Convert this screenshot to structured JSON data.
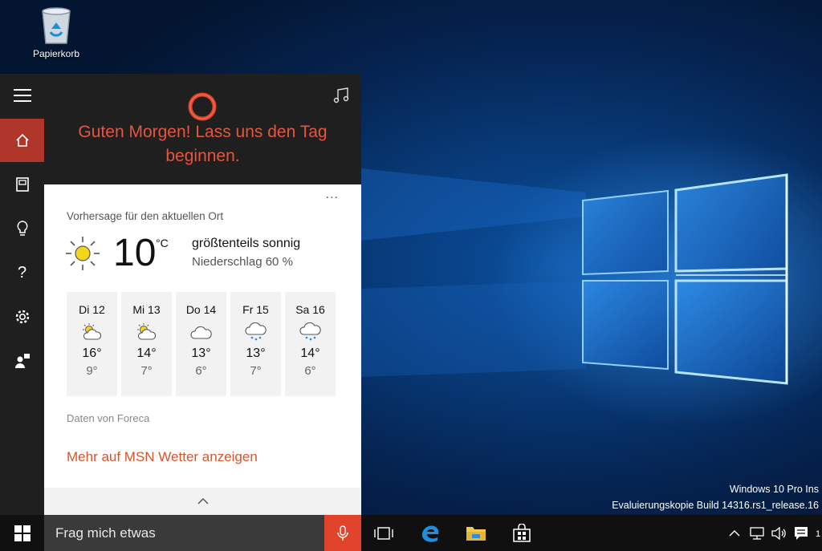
{
  "desktop": {
    "recycle_bin_label": "Papierkorb",
    "watermark_line1": "Windows 10 Pro Ins",
    "watermark_line2": "Evaluierungskopie Build 14316.rs1_release.16"
  },
  "cortana": {
    "greeting": "Guten Morgen! Lass uns den Tag beginnen.",
    "rail_items": [
      "menu-icon",
      "home-icon",
      "notebook-icon",
      "lightbulb-icon",
      "help-icon",
      "gear-icon",
      "feedback-icon"
    ],
    "accent_color": "#b0352a"
  },
  "weather": {
    "more_label": "...",
    "location_label": "Vorhersage für den aktuellen Ort",
    "temperature": "10",
    "unit": "°C",
    "condition": "größtenteils sonnig",
    "precipitation": "Niederschlag 60 %",
    "forecast": [
      {
        "day": "Di 12",
        "icon": "partly-sunny-icon",
        "high": "16°",
        "low": "9°"
      },
      {
        "day": "Mi 13",
        "icon": "partly-sunny-icon",
        "high": "14°",
        "low": "7°"
      },
      {
        "day": "Do 14",
        "icon": "cloudy-icon",
        "high": "13°",
        "low": "6°"
      },
      {
        "day": "Fr 15",
        "icon": "rain-icon",
        "high": "13°",
        "low": "7°"
      },
      {
        "day": "Sa 16",
        "icon": "rain-icon",
        "high": "14°",
        "low": "6°"
      }
    ],
    "source": "Daten von Foreca",
    "msn_link": "Mehr auf MSN Wetter anzeigen",
    "link_color": "#d9532c"
  },
  "taskbar": {
    "search_placeholder": "Frag mich etwas",
    "clock_fragment": "1"
  }
}
